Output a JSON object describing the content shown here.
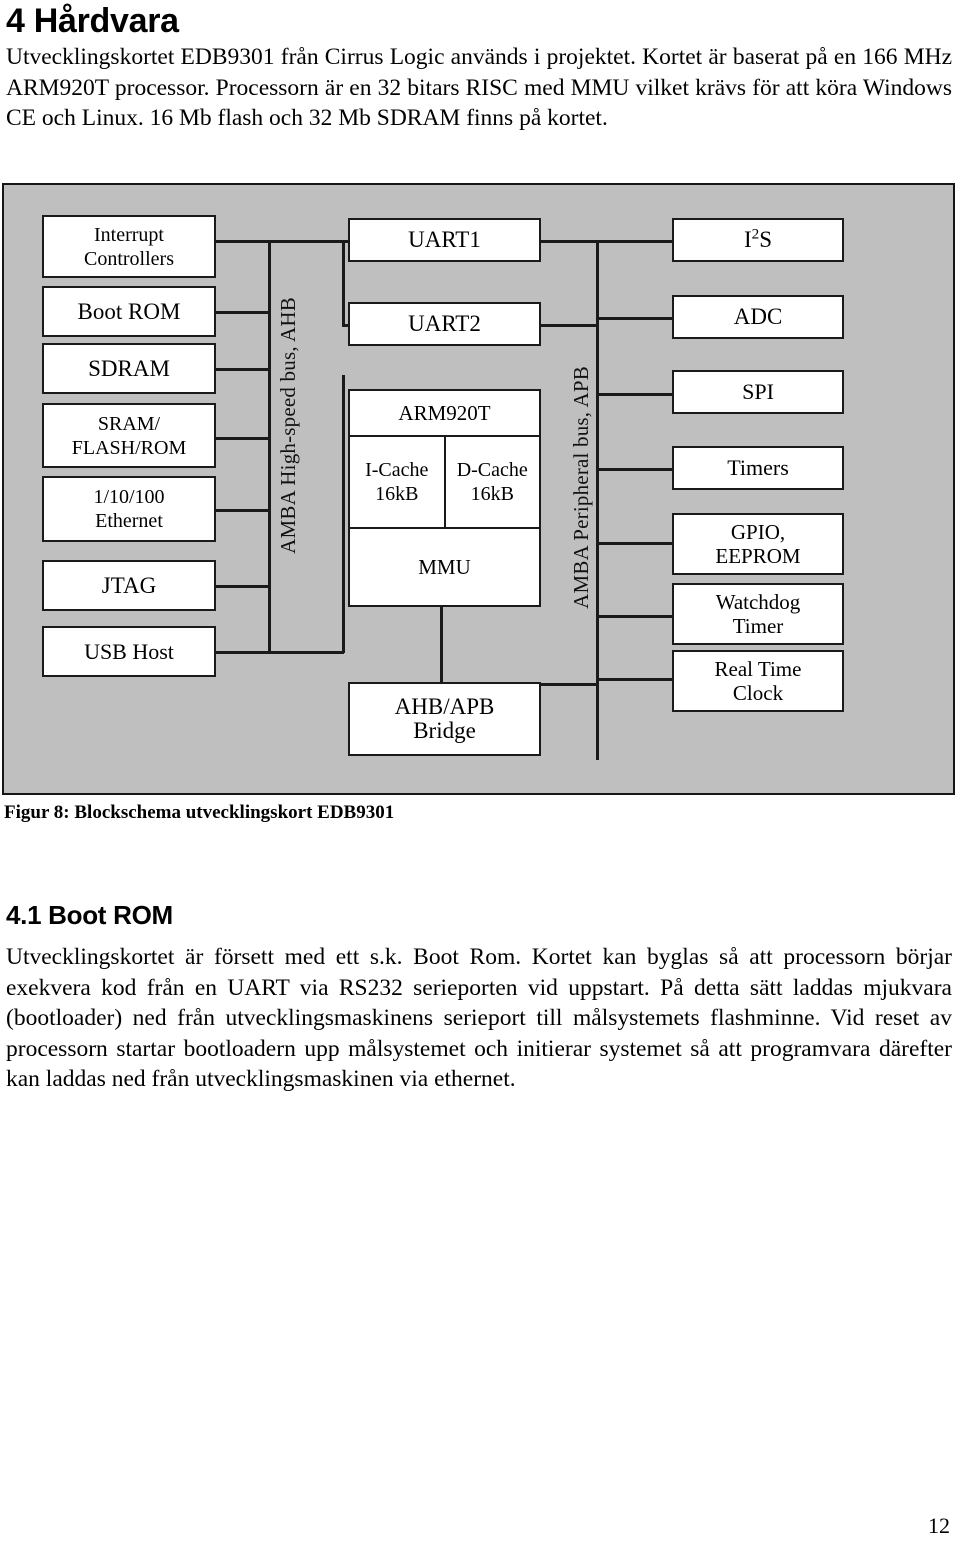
{
  "document": {
    "page_number": "12"
  },
  "sections": {
    "hardvara": {
      "heading": "4 Hårdvara",
      "paragraph": "Utvecklingskortet EDB9301 från Cirrus Logic används i projektet. Kortet är baserat på en 166 MHz ARM920T processor. Processorn är en 32 bitars RISC med MMU vilket krävs för att köra Windows CE och Linux. 16 Mb flash och 32 Mb SDRAM finns på kortet."
    },
    "boot_rom": {
      "heading": "4.1 Boot ROM",
      "paragraph": "Utvecklingskortet är försett med ett s.k. Boot Rom. Kortet kan byglas så att processorn börjar exekvera kod från en UART via RS232 serieporten vid uppstart. På detta sätt laddas mjukvara (bootloader) ned från utvecklingsmaskinens serieport till målsystemets flashminne. Vid reset av processorn startar bootloadern upp målsystemet och initierar systemet så att programvara därefter kan laddas ned från utvecklingsmaskinen via ethernet."
    }
  },
  "figure": {
    "caption": "Figur 8: Blockschema utvecklingskort EDB9301",
    "background_color": "#bfbfbf",
    "block_fill_color": "#ffffff",
    "line_color": "#1a1a1a",
    "ahb_bus_label": "AMBA High-speed bus, AHB",
    "apb_bus_label": "AMBA Peripheral bus, APB",
    "left_blocks": [
      {
        "label": "Interrupt\nControllers"
      },
      {
        "label": "Boot ROM"
      },
      {
        "label": "SDRAM"
      },
      {
        "label": "SRAM/\nFLASH/ROM"
      },
      {
        "label": "1/10/100\nEthernet"
      },
      {
        "label": "JTAG"
      },
      {
        "label": "USB Host"
      }
    ],
    "center_blocks": [
      {
        "label": "UART1"
      },
      {
        "label": "UART2"
      }
    ],
    "core": {
      "title": "ARM920T",
      "icache": "I-Cache\n16kB",
      "dcache": "D-Cache\n16kB",
      "mmu": "MMU"
    },
    "bridge": {
      "label": "AHB/APB\nBridge"
    },
    "right_blocks": [
      {
        "label": "I2S",
        "html": "I<sup>2</sup>S"
      },
      {
        "label": "ADC"
      },
      {
        "label": "SPI"
      },
      {
        "label": "Timers"
      },
      {
        "label": "GPIO,\nEEPROM"
      },
      {
        "label": "Watchdog\nTimer"
      },
      {
        "label": "Real Time\nClock"
      }
    ]
  }
}
